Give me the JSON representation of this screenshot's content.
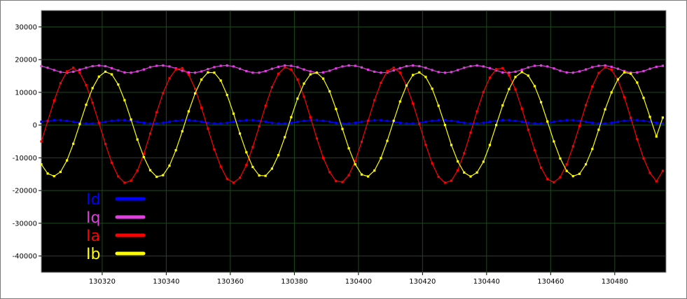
{
  "chart_data": {
    "type": "line",
    "grid": true,
    "legend_position": "bottom-left",
    "xlim": [
      130301,
      130496
    ],
    "ylim": [
      -45000,
      35000
    ],
    "x_ticks": [
      130320,
      130340,
      130360,
      130380,
      130400,
      130420,
      130440,
      130460,
      130480
    ],
    "y_ticks": [
      30000,
      20000,
      10000,
      0,
      -10000,
      -20000,
      -30000,
      -40000
    ],
    "x_tick_labels": [
      "130320",
      "130340",
      "130360",
      "130380",
      "130400",
      "130420",
      "130440",
      "130460",
      "130480"
    ],
    "y_tick_labels": [
      "30000",
      "20000",
      "10000",
      "0",
      "-10000",
      "-20000",
      "-30000",
      "-40000"
    ],
    "x_start": 130301,
    "x_end": 130495,
    "series": [
      {
        "name": "Id",
        "color": "#0000ff",
        "values": [
          1000,
          1300,
          1500,
          1500,
          1300,
          1000,
          700,
          500,
          500,
          700,
          1000,
          1300,
          1500,
          1500,
          1300,
          1000,
          700,
          500,
          500,
          700,
          1000,
          1300,
          1500,
          1500,
          1300,
          1000,
          700,
          500,
          500,
          700,
          1000,
          1300,
          1500,
          1500,
          1300,
          1000,
          700,
          500,
          500,
          700,
          1000,
          1300,
          1500,
          1500,
          1300,
          1000,
          700,
          500,
          500,
          700,
          1000,
          1300,
          1500,
          1500,
          1300,
          1000,
          700,
          500,
          500,
          700,
          1000,
          1300,
          1500,
          1500,
          1300,
          1000,
          700,
          500,
          500,
          700,
          1000,
          1300,
          1500,
          1500,
          1300,
          1000,
          700,
          500,
          500,
          700,
          1000,
          1300,
          1500,
          1500,
          1300,
          1000,
          700,
          500,
          500,
          700,
          1000,
          1300,
          1500,
          1500,
          1300,
          1000,
          700,
          500
        ]
      },
      {
        "name": "Iq",
        "color": "#e040e0",
        "values": [
          18000,
          17500,
          16800,
          16200,
          16000,
          16300,
          16900,
          17500,
          18000,
          18200,
          18000,
          17400,
          16700,
          16100,
          16000,
          16400,
          17000,
          17700,
          18100,
          18200,
          17900,
          17300,
          16600,
          16100,
          16000,
          16400,
          17100,
          17700,
          18100,
          18200,
          17900,
          17200,
          16500,
          16000,
          16000,
          16500,
          17200,
          17800,
          18200,
          18100,
          17700,
          17000,
          16400,
          16000,
          16100,
          16600,
          17300,
          17900,
          18200,
          18100,
          17600,
          16900,
          16300,
          16000,
          16100,
          16700,
          17400,
          18000,
          18200,
          18000,
          17500,
          16800,
          16200,
          16000,
          16200,
          16800,
          17500,
          18000,
          18200,
          17900,
          17400,
          16700,
          16100,
          16000,
          16300,
          16900,
          17600,
          18100,
          18200,
          17900,
          17300,
          16600,
          16100,
          16000,
          16400,
          17000,
          17700,
          18100,
          18200,
          17800,
          17200,
          16500,
          16000,
          16100,
          16500,
          17200,
          17800,
          18100
        ]
      },
      {
        "name": "Ia",
        "color": "#ff0000",
        "values": [
          -5000,
          1200,
          7500,
          12800,
          16400,
          17500,
          16000,
          12200,
          6800,
          600,
          -5800,
          -11500,
          -15700,
          -17600,
          -17000,
          -13900,
          -8800,
          -2600,
          3900,
          9800,
          14300,
          17000,
          17400,
          15400,
          11100,
          5300,
          -1100,
          -7400,
          -12700,
          -16400,
          -17600,
          -16100,
          -12200,
          -6700,
          -400,
          5900,
          11600,
          15700,
          17600,
          17000,
          13900,
          8700,
          2400,
          -4100,
          -10000,
          -14400,
          -17100,
          -17400,
          -15300,
          -11000,
          -5100,
          1300,
          7600,
          12900,
          16500,
          17500,
          16000,
          12100,
          6600,
          300,
          -6000,
          -11700,
          -15800,
          -17600,
          -17000,
          -13800,
          -8600,
          -2300,
          4200,
          10100,
          14500,
          17100,
          17400,
          15200,
          10900,
          5000,
          -1400,
          -7700,
          -13000,
          -16500,
          -17500,
          -15900,
          -12000,
          -6500,
          -200,
          6100,
          11800,
          15900,
          17600,
          16900,
          13700,
          8500,
          2200,
          -4300,
          -10200,
          -14600,
          -17200,
          -14000
        ]
      },
      {
        "name": "Ib",
        "color": "#ffff00",
        "values": [
          -12000,
          -14800,
          -15600,
          -14300,
          -10800,
          -5700,
          300,
          6200,
          11300,
          14800,
          16300,
          15500,
          12400,
          7600,
          1700,
          -4400,
          -9800,
          -13800,
          -15800,
          -15300,
          -12400,
          -7700,
          -1900,
          4200,
          9700,
          13900,
          16100,
          16000,
          13600,
          9200,
          3500,
          -2600,
          -8300,
          -12800,
          -15400,
          -15500,
          -13300,
          -9200,
          -3700,
          2400,
          8100,
          12700,
          15500,
          16000,
          14200,
          10300,
          4900,
          -1200,
          -7100,
          -12000,
          -15100,
          -15700,
          -13900,
          -10100,
          -4800,
          1300,
          7200,
          12100,
          15300,
          16100,
          14700,
          11100,
          5900,
          0,
          -6100,
          -11100,
          -14500,
          -15700,
          -14500,
          -11200,
          -6100,
          0,
          6000,
          11000,
          14700,
          16200,
          15100,
          11900,
          7000,
          1100,
          -5000,
          -10200,
          -14000,
          -15600,
          -14900,
          -12000,
          -7300,
          -1400,
          4800,
          10000,
          14000,
          16100,
          15700,
          13000,
          8300,
          2500,
          -3500,
          2300
        ]
      }
    ]
  }
}
